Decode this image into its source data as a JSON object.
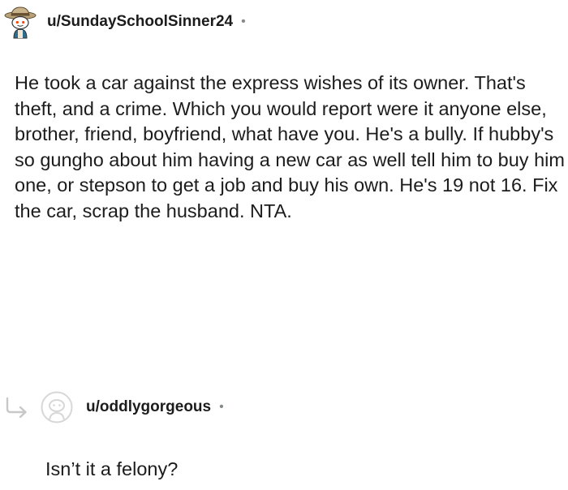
{
  "comment": {
    "username": "u/SundaySchoolSinner24",
    "separator": "•",
    "avatar_icon": "snoo-cowboy-avatar-icon",
    "body": "He took a car against the express wishes of its owner. That's theft, and a crime. Which you would report were it anyone else, brother, friend, boyfriend, what have you. He's a bully. If hubby's so gungho about him having a new car as well tell him to buy him one, or stepson to get a job and buy his own. He's 19 not 16. Fix the car, scrap the husband. NTA."
  },
  "reply": {
    "username": "u/oddlygorgeous",
    "separator": "•",
    "arrow_icon": "reply-arrow-icon",
    "avatar_icon": "default-avatar-icon",
    "body": "Isn’t it a felony?"
  },
  "colors": {
    "text": "#1c1c1c",
    "meta": "#878a8c",
    "icon_gray": "#c8c8c8"
  }
}
